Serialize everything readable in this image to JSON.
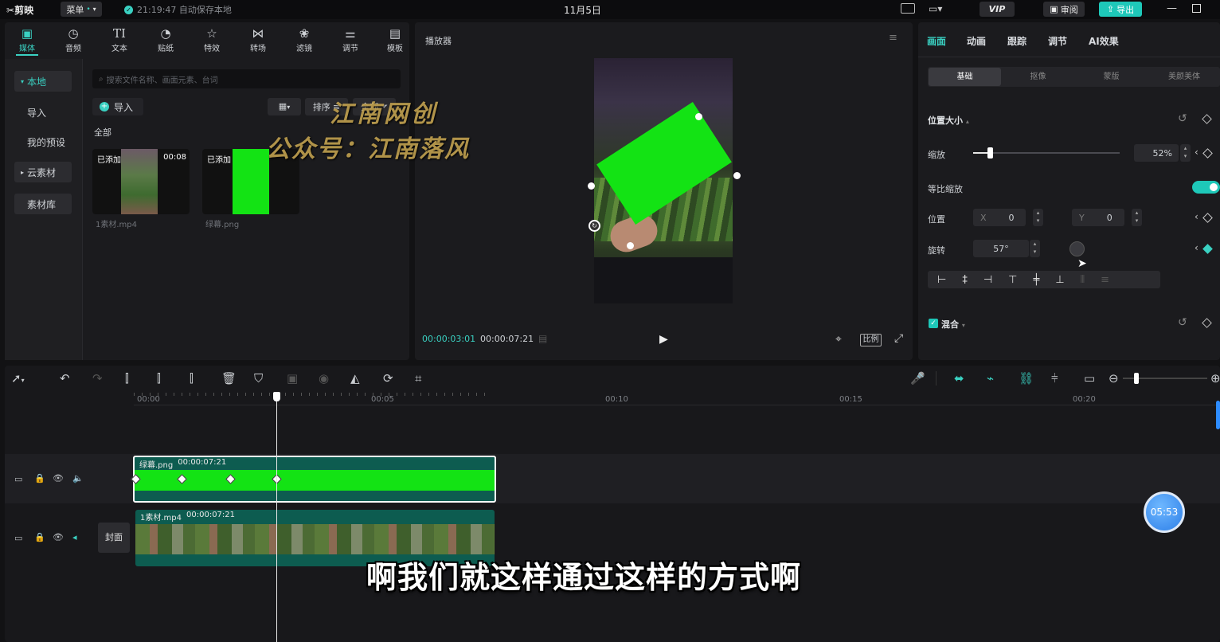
{
  "titlebar": {
    "app_name": "剪映",
    "menu_label": "菜单",
    "autosave": "21:19:47 自动保存本地",
    "date": "11月5日",
    "vip": "VIP",
    "review": "审阅",
    "export": "导出"
  },
  "toolbar": {
    "items": [
      {
        "label": "媒体"
      },
      {
        "label": "音频"
      },
      {
        "label": "文本"
      },
      {
        "label": "贴纸"
      },
      {
        "label": "特效"
      },
      {
        "label": "转场"
      },
      {
        "label": "滤镜"
      },
      {
        "label": "调节"
      },
      {
        "label": "模板"
      }
    ]
  },
  "sidebar": {
    "items": [
      {
        "label": "本地"
      },
      {
        "label": "导入"
      },
      {
        "label": "我的预设"
      },
      {
        "label": "云素材"
      },
      {
        "label": "素材库"
      }
    ]
  },
  "media": {
    "search_placeholder": "搜索文件名称、画面元素、台词",
    "import_label": "导入",
    "sort_label": "排序",
    "filter_label": "全部",
    "all_label": "全部",
    "items": [
      {
        "badge": "已添加",
        "duration": "00:08",
        "name": "1素材.mp4"
      },
      {
        "badge": "已添加",
        "duration": "",
        "name": "绿幕.png"
      }
    ]
  },
  "watermark": {
    "line1": "江南网创",
    "line2": "公众号：江南落风"
  },
  "player": {
    "title": "播放器",
    "current_time": "00:00:03:01",
    "total_time": "00:00:07:21",
    "ratio_label": "比例"
  },
  "props": {
    "tabs": [
      {
        "label": "画面"
      },
      {
        "label": "动画"
      },
      {
        "label": "跟踪"
      },
      {
        "label": "调节"
      },
      {
        "label": "AI效果"
      }
    ],
    "subtabs": [
      {
        "label": "基础"
      },
      {
        "label": "抠像"
      },
      {
        "label": "蒙版"
      },
      {
        "label": "美颜美体"
      }
    ],
    "section_title": "位置大小",
    "scale_label": "缩放",
    "scale_value": "52%",
    "scale_level": 0.52,
    "uniform_label": "等比缩放",
    "position_label": "位置",
    "x_label": "X",
    "x_value": "0",
    "y_label": "Y",
    "y_value": "0",
    "rotate_label": "旋转",
    "rotate_value": "57°",
    "blend_label": "混合"
  },
  "timeline": {
    "ruler": [
      "00:00",
      "00:05",
      "00:10",
      "00:15",
      "00:20"
    ],
    "cover_label": "封面",
    "clip1": {
      "name": "绿幕.png",
      "duration": "00:00:07:21"
    },
    "clip2": {
      "name": "1素材.mp4",
      "duration": "00:00:07:21"
    }
  },
  "subtitle": "啊我们就这样通过这样的方式啊",
  "floating_timer": "05:53",
  "colors": {
    "accent": "#3ad1c2",
    "green_screen": "#13e314",
    "export_bg": "#1ec8b9"
  }
}
